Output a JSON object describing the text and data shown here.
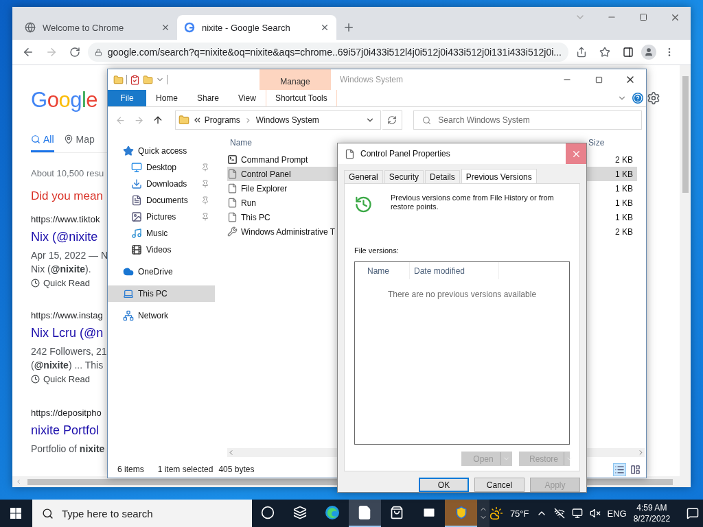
{
  "browser": {
    "tabs": [
      {
        "label": "Welcome to Chrome",
        "selected": false,
        "kind": "globe"
      },
      {
        "label": "nixite - Google Search",
        "selected": true,
        "kind": "google"
      }
    ],
    "url": "google.com/search?q=nixite&oq=nixite&aqs=chrome..69i57j0i433i512l4j0i512j0i433i512j0i131i433i512j0i...",
    "page": {
      "logo": "Google",
      "search_tabs": [
        {
          "label": "All",
          "selected": true,
          "kind": "search"
        },
        {
          "label": "Map",
          "selected": false,
          "kind": "pin"
        }
      ],
      "result_count": "About 10,500 resu",
      "did_you_mean": "Did you mean",
      "results": [
        {
          "url": "https://www.tiktok",
          "title": "Nix (@nixite",
          "snippet": [
            "Apr 15, 2022 — N",
            "Nix (**@nixite**)."
          ],
          "quick_read": "Quick Read"
        },
        {
          "url": "https://www.instag",
          "title": "Nix Lcru (@n",
          "snippet": [
            "242 Followers, 21",
            "(**@nixite**) ... This"
          ],
          "quick_read": "Quick Read"
        },
        {
          "url": "https://depositpho",
          "title": "nixite Portfol",
          "snippet": [
            "Portfolio of **nixite**"
          ]
        }
      ]
    }
  },
  "explorer": {
    "context_tab": "Manage",
    "title": "Windows System",
    "ribbon_tabs": [
      {
        "label": "File",
        "kind": "file"
      },
      {
        "label": "Home",
        "kind": "tab"
      },
      {
        "label": "Share",
        "kind": "tab"
      },
      {
        "label": "View",
        "kind": "tab"
      },
      {
        "label": "Shortcut Tools",
        "kind": "context"
      }
    ],
    "breadcrumb": [
      "Programs",
      "Windows System"
    ],
    "search_placeholder": "Search Windows System",
    "nav": [
      {
        "label": "Quick access",
        "kind": "star",
        "selected": false,
        "children": [
          {
            "label": "Desktop",
            "kind": "desktop",
            "selected": false,
            "pinned": true
          },
          {
            "label": "Downloads",
            "kind": "downloads",
            "selected": false,
            "pinned": true
          },
          {
            "label": "Documents",
            "kind": "documents",
            "selected": false,
            "pinned": true
          },
          {
            "label": "Pictures",
            "kind": "pictures",
            "selected": false,
            "pinned": true
          },
          {
            "label": "Music",
            "kind": "music",
            "selected": false,
            "pinned": false
          },
          {
            "label": "Videos",
            "kind": "videos",
            "selected": false,
            "pinned": false
          }
        ]
      },
      {
        "label": "OneDrive",
        "kind": "cloud",
        "selected": false
      },
      {
        "label": "This PC",
        "kind": "pc",
        "selected": true
      },
      {
        "label": "Network",
        "kind": "network",
        "selected": false
      }
    ],
    "columns": {
      "name": "Name",
      "size": "Size"
    },
    "files": [
      {
        "name": "Command Prompt",
        "size": "2 KB",
        "kind": "console",
        "selected": false
      },
      {
        "name": "Control Panel",
        "size": "1 KB",
        "kind": "shortcut",
        "selected": true
      },
      {
        "name": "File Explorer",
        "size": "1 KB",
        "kind": "shortcut",
        "selected": false
      },
      {
        "name": "Run",
        "size": "1 KB",
        "kind": "shortcut",
        "selected": false
      },
      {
        "name": "This PC",
        "size": "1 KB",
        "kind": "shortcut",
        "selected": false
      },
      {
        "name": "Windows Administrative T",
        "size": "2 KB",
        "kind": "tools",
        "selected": false
      }
    ],
    "status": {
      "count": "6 items",
      "selection": "1 item selected",
      "bytes": "405 bytes"
    }
  },
  "dialog": {
    "title": "Control Panel Properties",
    "close": {
      "hovered": true
    },
    "tabs": [
      {
        "label": "General",
        "selected": false
      },
      {
        "label": "Security",
        "selected": false
      },
      {
        "label": "Details",
        "selected": false
      },
      {
        "label": "Previous Versions",
        "selected": true
      }
    ],
    "info": "Previous versions come from File History or from restore points.",
    "list_label": "File versions:",
    "columns": [
      "Name",
      "Date modified"
    ],
    "empty": "There are no previous versions available",
    "split_buttons": [
      {
        "label": "Open",
        "disabled": true
      },
      {
        "label": "Restore",
        "disabled": true
      }
    ],
    "buttons": [
      {
        "label": "OK",
        "default": true,
        "disabled": false
      },
      {
        "label": "Cancel",
        "default": false,
        "disabled": false
      },
      {
        "label": "Apply",
        "default": false,
        "disabled": true
      }
    ]
  },
  "taskbar": {
    "search_placeholder": "Type here to search",
    "apps": [
      {
        "kind": "cortana",
        "active": false
      },
      {
        "kind": "taskview",
        "active": false
      },
      {
        "kind": "edge",
        "active": false
      },
      {
        "kind": "file",
        "active": true
      },
      {
        "kind": "store",
        "active": false
      },
      {
        "kind": "mail",
        "active": false
      },
      {
        "kind": "shield",
        "active": true
      }
    ],
    "weather": "75°F",
    "language": "ENG",
    "time": "4:59 AM",
    "date": "8/27/2022"
  }
}
